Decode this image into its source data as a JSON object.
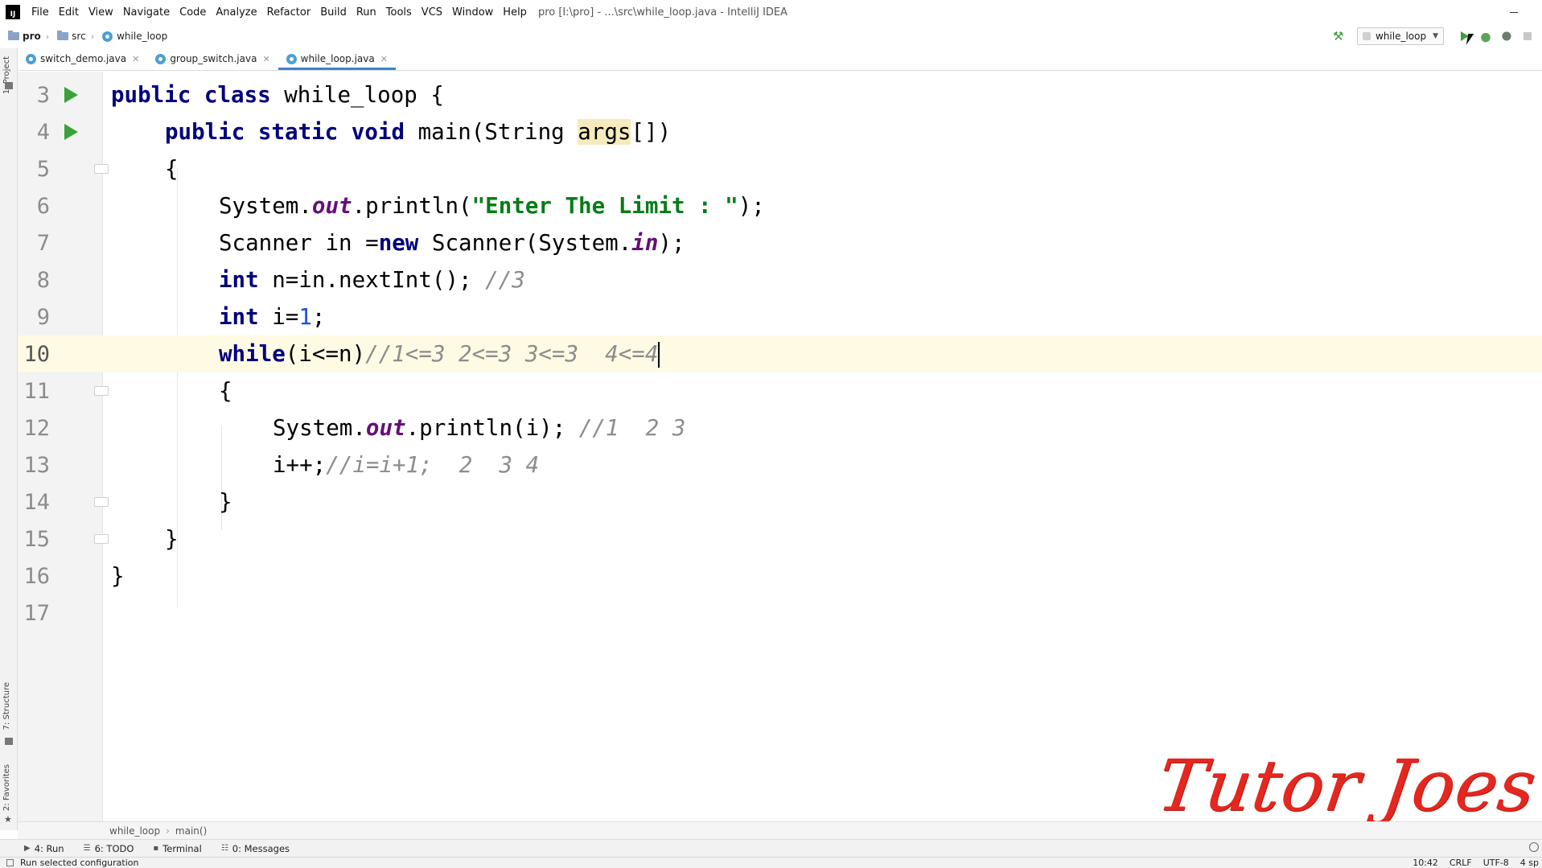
{
  "menubar": {
    "logo": "IJ",
    "items": [
      "File",
      "Edit",
      "View",
      "Navigate",
      "Code",
      "Analyze",
      "Refactor",
      "Build",
      "Run",
      "Tools",
      "VCS",
      "Window",
      "Help"
    ],
    "window_title": "pro [I:\\pro] - ...\\src\\while_loop.java - IntelliJ IDEA"
  },
  "navbar": {
    "crumbs": [
      "pro",
      "src",
      "while_loop"
    ],
    "run_config": "while_loop"
  },
  "tabs": [
    {
      "label": "switch_demo.java",
      "active": false
    },
    {
      "label": "group_switch.java",
      "active": false
    },
    {
      "label": "while_loop.java",
      "active": true
    }
  ],
  "side_panels": {
    "project": "1: Project",
    "structure": "7: Structure",
    "favorites": "2: Favorites"
  },
  "editor": {
    "line_numbers": [
      "3",
      "4",
      "5",
      "6",
      "7",
      "8",
      "9",
      "10",
      "11",
      "12",
      "13",
      "14",
      "15",
      "16",
      "17"
    ],
    "current_line": "10",
    "tokens": {
      "l3_kw": "public class",
      "l3_rest": " while_loop {",
      "l4_kw": "public static void",
      "l4_a": " main(String ",
      "l4_hl": "args",
      "l4_b": "[])",
      "l5": "{",
      "l6_a": "System.",
      "l6_fld": "out",
      "l6_b": ".println(",
      "l6_str": "\"Enter The Limit : \"",
      "l6_c": ");",
      "l7_a": "Scanner in =",
      "l7_kw": "new",
      "l7_b": " Scanner(System.",
      "l7_fld": "in",
      "l7_c": ");",
      "l8_kw": "int",
      "l8_a": " n=in.nextInt(); ",
      "l8_cmt": "//3",
      "l9_kw": "int",
      "l9_a": " i=",
      "l9_num": "1",
      "l9_b": ";",
      "l10_kw": "while",
      "l10_a": "(i<=n)",
      "l10_cmt": "//1<=3 2<=3 3<=3  4<=4",
      "l11": "{",
      "l12_a": "System.",
      "l12_fld": "out",
      "l12_b": ".println(i); ",
      "l12_cmt": "//1  2 3",
      "l13_a": "i++;",
      "l13_cmt": "//i=i+1;  2  3 4",
      "l14": "}",
      "l15": "}",
      "l16": "}"
    }
  },
  "watermark": "Tutor Joes",
  "editor_breadcrumb": [
    "while_loop",
    "main()"
  ],
  "bottom_tools": [
    {
      "icon": "run-icon",
      "label": "4: Run"
    },
    {
      "icon": "todo-icon",
      "label": "6: TODO"
    },
    {
      "icon": "terminal-icon",
      "label": "Terminal"
    },
    {
      "icon": "messages-icon",
      "label": "0: Messages"
    }
  ],
  "status": {
    "message": "Run selected configuration",
    "position": "10:42",
    "line_sep": "CRLF",
    "encoding": "UTF-8",
    "indent": "4 sp"
  },
  "colors": {
    "keyword": "#00007d",
    "string": "#067d17",
    "field": "#660e7a",
    "comment": "#8c8c8c",
    "number": "#1750eb",
    "current_line": "#fffae3",
    "watermark": "#e4271f"
  }
}
